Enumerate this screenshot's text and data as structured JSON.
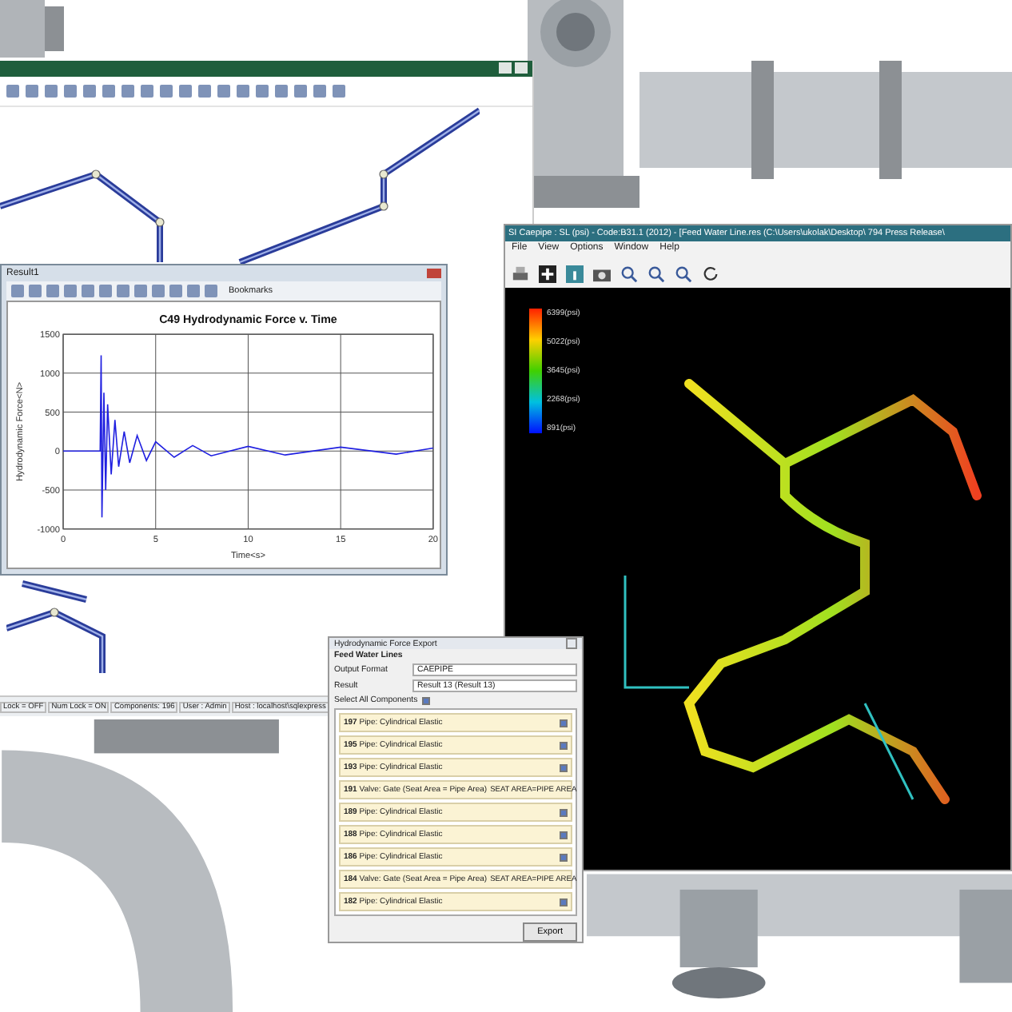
{
  "main_window": {
    "status_bar": [
      "Lock = OFF",
      "Num Lock = ON",
      "Components: 196",
      "User : Admin",
      "Host : localhost\\sqlexpress"
    ]
  },
  "result_window": {
    "title": "Result1",
    "toolbar_label": "Bookmarks",
    "chart_data": {
      "type": "line",
      "title": "C49 Hydrodynamic Force v. Time",
      "xlabel": "Time<s>",
      "ylabel": "Hydrodynamic Force<N>",
      "xlim": [
        0,
        20
      ],
      "ylim": [
        -1000,
        1500
      ],
      "xticks": [
        0,
        5,
        10,
        15,
        20
      ],
      "yticks": [
        -1000,
        -500,
        0,
        500,
        1000,
        1500
      ],
      "x": [
        0,
        2,
        2.05,
        2.1,
        2.2,
        2.3,
        2.4,
        2.6,
        2.8,
        3,
        3.3,
        3.6,
        4,
        4.5,
        5,
        6,
        7,
        8,
        10,
        12,
        15,
        18,
        20
      ],
      "grid": true,
      "series": [
        {
          "color": "#2020e0",
          "values": [
            0,
            0,
            1230,
            -850,
            750,
            -500,
            600,
            -300,
            400,
            -200,
            250,
            -150,
            200,
            -120,
            120,
            -80,
            70,
            -60,
            60,
            -50,
            50,
            -40,
            40
          ]
        }
      ]
    }
  },
  "viewer_window": {
    "title": "SI Caepipe : SL (psi) - Code:B31.1 (2012) - [Feed Water Line.res (C:\\Users\\ukolak\\Desktop\\ 794 Press Release\\",
    "menu": [
      "File",
      "View",
      "Options",
      "Window",
      "Help"
    ],
    "legend": [
      "6399(psi)",
      "5022(psi)",
      "3645(psi)",
      "2268(psi)",
      "891(psi)"
    ]
  },
  "export_dialog": {
    "title": "Hydrodynamic Force Export",
    "group": "Feed Water Lines",
    "fields": [
      {
        "label": "Output Format",
        "value": "CAEPIPE"
      },
      {
        "label": "Result",
        "value": "Result 13 (Result 13)"
      }
    ],
    "select_all": {
      "label": "Select All Components",
      "checked": true
    },
    "components": [
      {
        "kind": "pipe",
        "number": "197",
        "label": "Pipe: Cylindrical Elastic",
        "checked": true
      },
      {
        "kind": "pipe",
        "number": "195",
        "label": "Pipe: Cylindrical Elastic",
        "checked": true
      },
      {
        "kind": "pipe",
        "number": "193",
        "label": "Pipe: Cylindrical Elastic",
        "checked": true
      },
      {
        "kind": "valve",
        "number": "191",
        "label": "Valve: Gate (Seat Area = Pipe Area)",
        "note": "SEAT AREA=PIPE AREA"
      },
      {
        "kind": "pipe",
        "number": "189",
        "label": "Pipe: Cylindrical Elastic",
        "checked": true
      },
      {
        "kind": "pipe",
        "number": "188",
        "label": "Pipe: Cylindrical Elastic",
        "checked": true
      },
      {
        "kind": "pipe",
        "number": "186",
        "label": "Pipe: Cylindrical Elastic",
        "checked": true
      },
      {
        "kind": "valve",
        "number": "184",
        "label": "Valve: Gate (Seat Area = Pipe Area)",
        "note": "SEAT AREA=PIPE AREA"
      },
      {
        "kind": "pipe",
        "number": "182",
        "label": "Pipe: Cylindrical Elastic",
        "checked": true
      }
    ],
    "button": "Export"
  }
}
